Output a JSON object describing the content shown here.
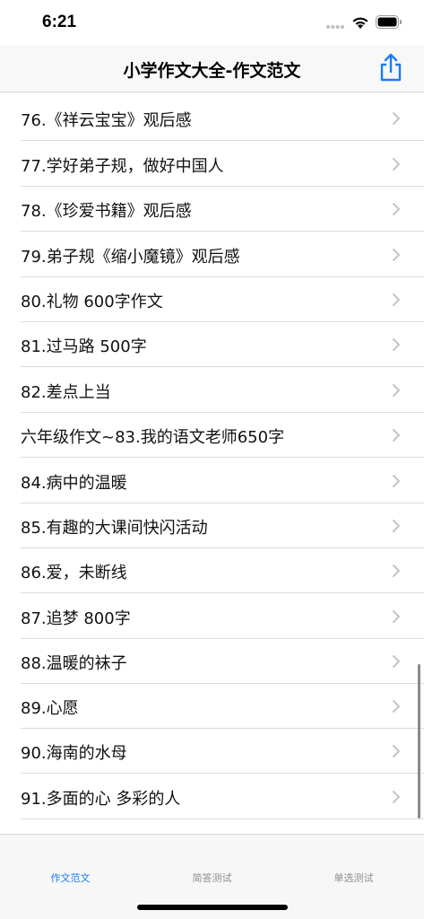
{
  "status_bar": {
    "time": "6:21"
  },
  "nav": {
    "title": "小学作文大全-作文范文",
    "share_icon": "share-icon"
  },
  "list": {
    "items": [
      {
        "label": "76.《祥云宝宝》观后感"
      },
      {
        "label": "77.学好弟子规，做好中国人"
      },
      {
        "label": "78.《珍爱书籍》观后感"
      },
      {
        "label": "79.弟子规《缩小魔镜》观后感"
      },
      {
        "label": "80.礼物 600字作文"
      },
      {
        "label": "81.过马路 500字"
      },
      {
        "label": "82.差点上当"
      },
      {
        "label": "六年级作文~83.我的语文老师650字"
      },
      {
        "label": "84.病中的温暖"
      },
      {
        "label": "85.有趣的大课间快闪活动"
      },
      {
        "label": "86.爱，未断线"
      },
      {
        "label": "87.追梦 800字"
      },
      {
        "label": "88.温暖的袜子"
      },
      {
        "label": "89.心愿"
      },
      {
        "label": "90.海南的水母"
      },
      {
        "label": "91.多面的心  多彩的人"
      }
    ]
  },
  "tabs": [
    {
      "label": "作文范文",
      "active": true
    },
    {
      "label": "简答测试",
      "active": false
    },
    {
      "label": "单选测试",
      "active": false
    }
  ],
  "colors": {
    "accent": "#1a7cf5",
    "inactive_tab": "#8e8e93"
  }
}
